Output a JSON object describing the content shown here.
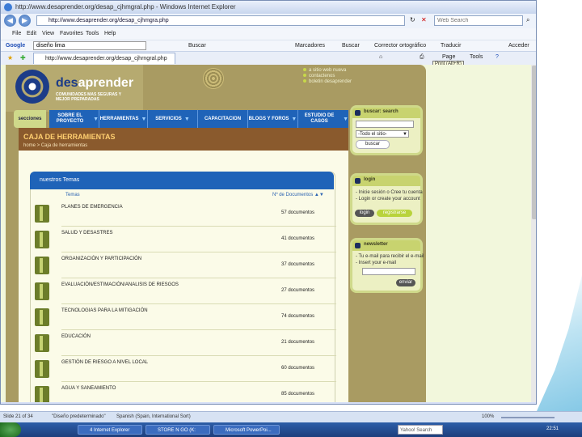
{
  "window": {
    "title": "http://www.desaprender.org/desap_cjhmgral.php - Windows Internet Explorer",
    "address": "http://www.desaprender.org/desap_cjhmgra.php",
    "search_placeholder": "Web Search"
  },
  "menu": [
    "File",
    "Edit",
    "View",
    "Favorites",
    "Tools",
    "Help"
  ],
  "google_toolbar": {
    "brand": "Google",
    "query": "diseño lima",
    "items": [
      "Buscar",
      "Marcadores",
      "Buscar",
      "Corrector ortográfico",
      "Traducir",
      "Acceder"
    ]
  },
  "tab": {
    "label": "http://www.desaprender.org/desap_cjhrngral.php",
    "page_menu": "Page",
    "tools_menu": "Tools",
    "tooltip": "Print (Alt+R)"
  },
  "site": {
    "logo_prefix": "des",
    "logo_suffix": "aprender",
    "tagline": "COMUNIDADES MAS SEGURAS Y MEJOR PREPARADAS",
    "header_links": [
      "a sitio web nueva",
      "contactenos",
      "boletin desaprender"
    ],
    "secciones_label": "secciones",
    "nav": [
      {
        "label": "SOBRE EL PROYECTO"
      },
      {
        "label": "HERRAMIENTAS"
      },
      {
        "label": "SERVICIOS"
      },
      {
        "label": "CAPACITACION"
      },
      {
        "label": "BLOGS Y FOROS"
      },
      {
        "label": "ESTUDIO DE CASOS"
      }
    ],
    "page_title": "CAJA DE HERRAMIENTAS",
    "breadcrumb": "home > Caja de herramientas",
    "topics_title": "nuestros Temas",
    "col_temas": "Temas",
    "col_docs": "Nº de Documentos",
    "topics": [
      {
        "title": "PLANES DE EMERGENCIA",
        "count": "57 documentos"
      },
      {
        "title": "SALUD Y DESASTRES",
        "count": "41 documentos"
      },
      {
        "title": "ORGANIZACIÓN Y PARTICIPACIÓN",
        "count": "37 documentos"
      },
      {
        "title": "EVALUACIÓN/ESTIMACIÓN/ANALISIS DE RIESGOS",
        "count": "27 documentos"
      },
      {
        "title": "TECNOLOGIAS PARA LA MITIGACIÓN",
        "count": "74 documentos"
      },
      {
        "title": "EDUCACIÓN",
        "count": "21 documentos"
      },
      {
        "title": "GESTIÓN DE RIESGO A NIVEL LOCAL",
        "count": "60 documentos"
      },
      {
        "title": "AGUA Y SANEAMIENTO",
        "count": "85 documentos"
      }
    ],
    "search_panel": {
      "title": "buscar: search",
      "select_value": "-Todo el sitio-",
      "button": "buscar"
    },
    "login_panel": {
      "title": "login",
      "line1": "- Inicie sesión o Cree tu cuenta",
      "line2": "- Login or create your account",
      "login_btn": "login",
      "register_btn": "registrarse"
    },
    "newsletter_panel": {
      "title": "newsletter",
      "line1": "- Tu e-mail para recibir el e-mail",
      "line2": "- Insert your e-mail",
      "button": "enviar"
    }
  },
  "statusbar": {
    "slide": "Slide 21 of 34",
    "theme": "\"Diseño predeterminado\"",
    "language": "Spanish (Spain, International Sort)",
    "zoom": "100%"
  },
  "taskbar": {
    "buttons": [
      "4 Internet Explorer",
      "STORE N GO (K:",
      "Microsoft PowerPoi..."
    ],
    "search": "Yahoo! Search",
    "clock": "22:51"
  }
}
